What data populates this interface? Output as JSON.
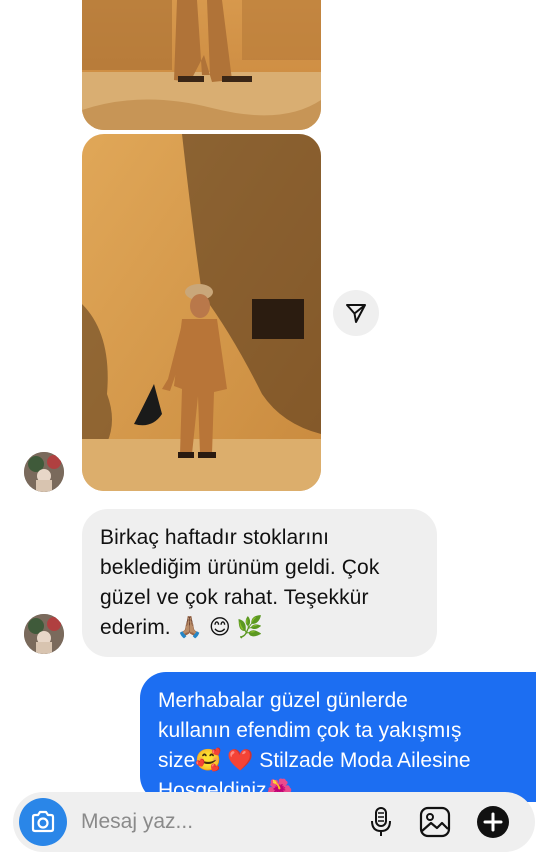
{
  "messages": {
    "incoming_text_lines": [
      "Birkaç haftadır stoklarını",
      "beklediğim ürünüm geldi. Çok",
      "güzel ve çok rahat. Teşekkür",
      "ederim. 🙏🏽 😊 🌿"
    ],
    "outgoing_text_lines": [
      "Merhabalar güzel günlerde",
      "kullanın efendim çok ta yakışmış",
      "size🥰 ❤️  Stilzade Moda Ailesine",
      "Hoşgeldiniz🌺"
    ]
  },
  "composer": {
    "placeholder": "Mesaj yaz..."
  },
  "icons": {
    "share": "paper-plane-icon",
    "camera": "camera-icon",
    "mic": "microphone-icon",
    "gallery": "image-icon",
    "add": "plus-icon"
  },
  "colors": {
    "outgoing_bubble": "#1c6ef2",
    "incoming_bubble": "#efefef",
    "camera_button": "#2a86e8"
  }
}
